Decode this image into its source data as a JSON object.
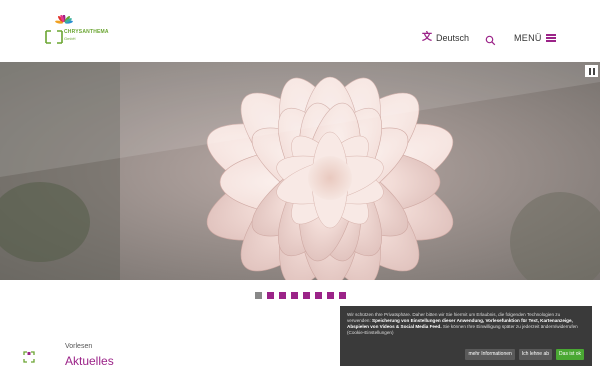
{
  "brand": {
    "name": "CHRYSANTHEMA",
    "subtitle": "GmbH",
    "colors": {
      "primary": "#9b2388",
      "logo_green": "#6aa531",
      "cookie_bg": "#3a3a3a",
      "accept_green": "#4aa833"
    }
  },
  "header": {
    "language_icon": "translate-icon",
    "language_label": "Deutsch",
    "search_icon": "search-icon",
    "menu_label": "MENÜ",
    "menu_icon": "hamburger-icon"
  },
  "hero": {
    "image": "pale pink chrysanthemum flower",
    "pause_icon": "pause-icon"
  },
  "slider": {
    "dot_count": 8,
    "active_index": 0
  },
  "section": {
    "overline": "Vorlesen",
    "title": "Aktuelles"
  },
  "side": {
    "focus_icon": "focus-frame-icon",
    "scroll_icon": "chevron-up-icon"
  },
  "cookie": {
    "text_1": "Wir schützen Ihre Privatsphäre. Daher bitten wir Sie hiermit um Erlaubnis, die folgenden Technologien zu verwenden: ",
    "text_bold_1": "Speicherung von Einstellungen dieser Anwendung, Vorlesefunktion für Text, Kartenanzeige, Abspielen von Videos & Social Media Feed.",
    "text_2": " Sie können Ihre Einwilligung später zu jederzeit ändern/widerrufen (Cookie-Einstellungen)",
    "more_label": "mehr Informationen",
    "decline_label": "Ich lehne ab",
    "accept_label": "Das ist ok"
  }
}
